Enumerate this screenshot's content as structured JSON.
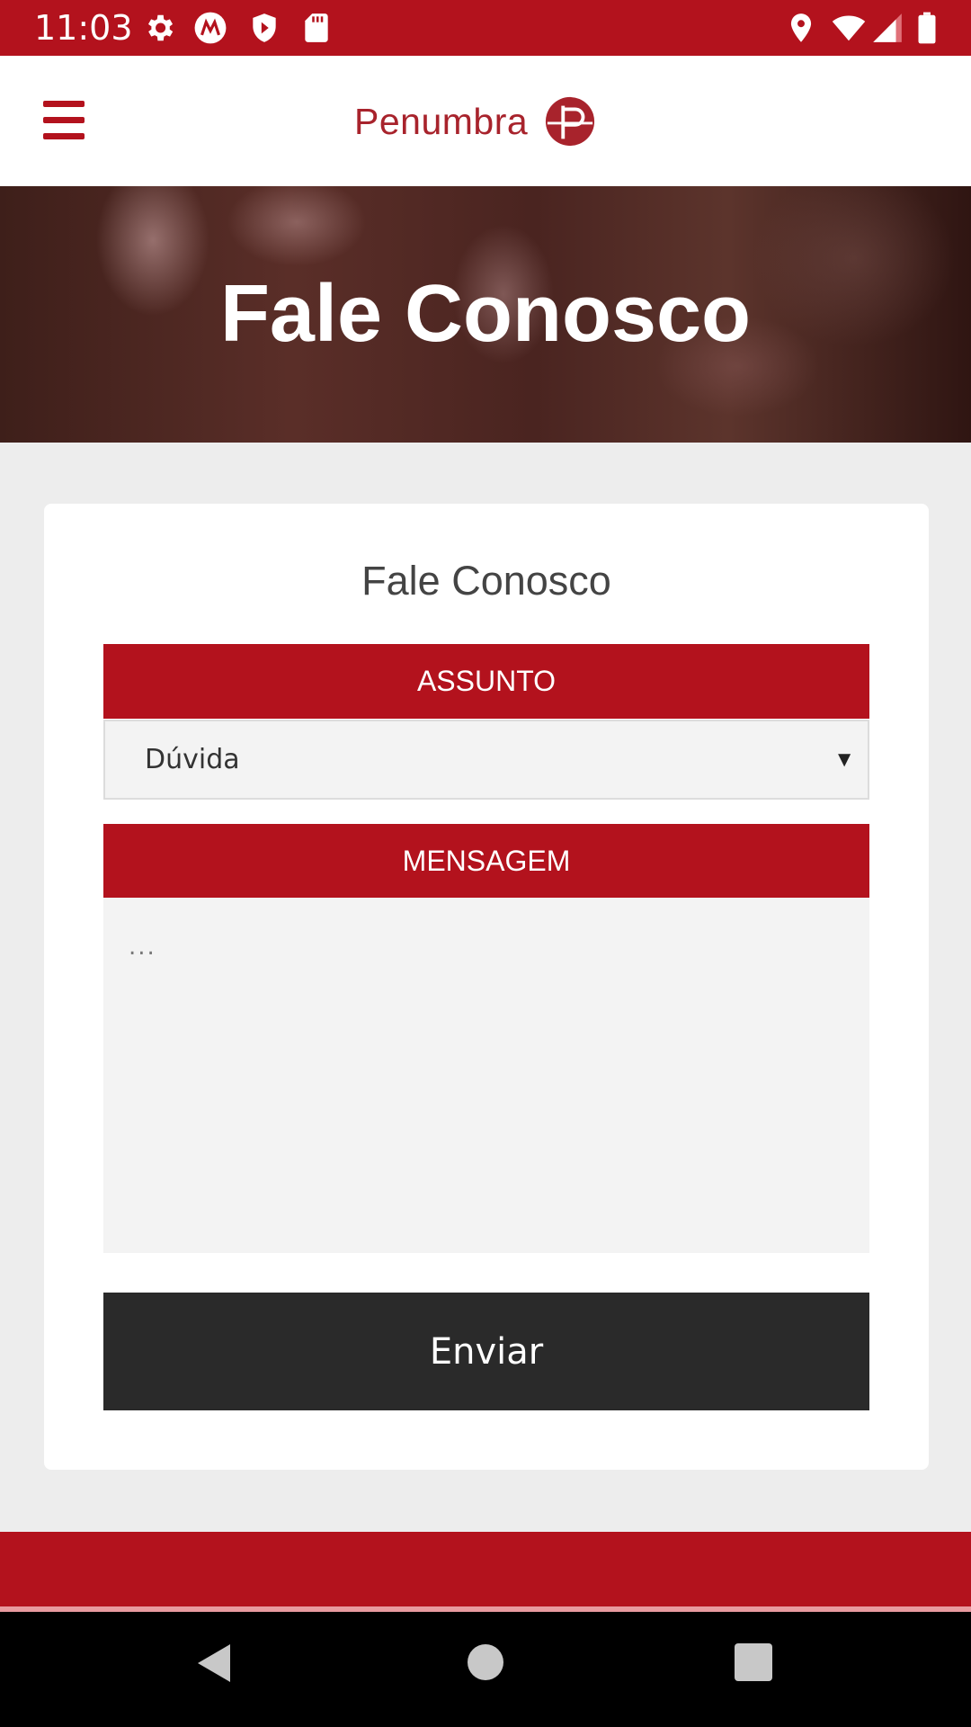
{
  "status_bar": {
    "time": "11:03",
    "left_icons": [
      "settings-icon",
      "motorola-icon",
      "play-protect-icon",
      "sd-card-icon"
    ],
    "right_icons": [
      "location-icon",
      "wifi-icon",
      "signal-icon",
      "battery-icon"
    ]
  },
  "header": {
    "menu_icon": "hamburger-menu-icon",
    "logo_text": "Penumbra"
  },
  "hero": {
    "title": "Fale Conosco"
  },
  "form": {
    "title": "Fale Conosco",
    "subject_label": "ASSUNTO",
    "subject_value": "Dúvida",
    "subject_arrow": "▼",
    "message_label": "MENSAGEM",
    "message_placeholder": "...",
    "send_label": "Enviar"
  },
  "colors": {
    "brand_red": "#b3121d",
    "button_dark": "#2a2a2a",
    "page_background": "#ededed"
  },
  "nav_bar": {
    "icons": [
      "back-icon",
      "home-icon",
      "recent-apps-icon"
    ]
  }
}
